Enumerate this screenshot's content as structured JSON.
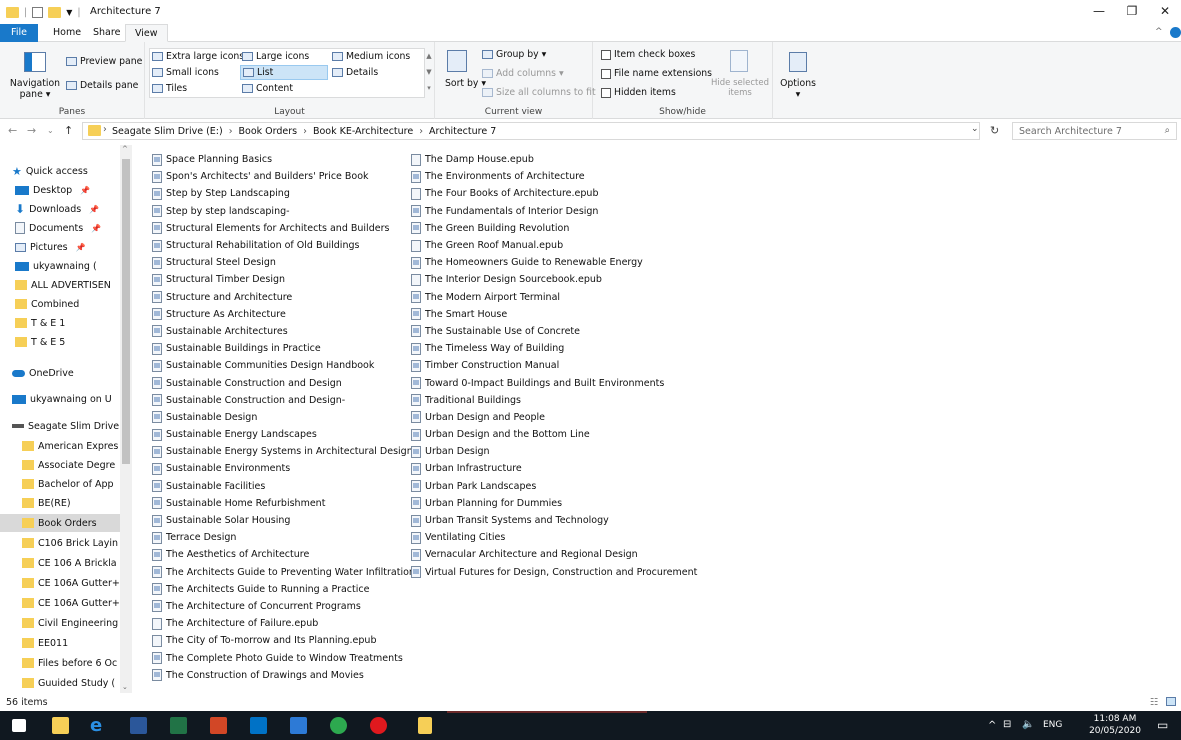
{
  "window": {
    "title": "Architecture 7"
  },
  "tabs": [
    "File",
    "Home",
    "Share",
    "View"
  ],
  "ribbon": {
    "panes": {
      "navigation_pane": "Navigation pane",
      "preview_pane": "Preview pane",
      "details_pane": "Details pane",
      "group_label": "Panes"
    },
    "layout": {
      "items": [
        "Extra large icons",
        "Large icons",
        "Medium icons",
        "Small icons",
        "List",
        "Details",
        "Tiles",
        "Content"
      ],
      "selected": "List",
      "group_label": "Layout"
    },
    "current_view": {
      "sort_by": "Sort by",
      "group_by": "Group by",
      "add_columns": "Add columns",
      "size_all_columns": "Size all columns to fit",
      "group_label": "Current view"
    },
    "show_hide": {
      "item_check_boxes": "Item check boxes",
      "file_name_extensions": "File name extensions",
      "hidden_items": "Hidden items",
      "hide_selected": "Hide selected items",
      "group_label": "Show/hide"
    },
    "options": "Options"
  },
  "address": {
    "breadcrumbs": [
      "Seagate Slim Drive (E:)",
      "Book Orders",
      "Book KE-Architecture",
      "Architecture 7"
    ],
    "search_placeholder": "Search Architecture 7"
  },
  "nav": {
    "quick_access": "Quick access",
    "quick_items": [
      "Desktop",
      "Downloads",
      "Documents",
      "Pictures",
      "ukyawnaing (",
      "ALL ADVERTISEN",
      "Combined",
      "T & E 1",
      "T & E 5"
    ],
    "onedrive": "OneDrive",
    "user": "ukyawnaing on U",
    "drive": "Seagate Slim Drive",
    "drive_items": [
      "American Expres",
      "Associate Degre",
      "Bachelor of App",
      "BE(RE)",
      "Book Orders",
      "C106 Brick Layin",
      "CE 106 A Brickla",
      "CE 106A Gutter+",
      "CE 106A Gutter+",
      "Civil Engineering",
      "EE011",
      "Files before 6 Oc",
      "Guuided Study ("
    ],
    "active": "Book Orders"
  },
  "files": {
    "col1": [
      {
        "name": "Space Planning Basics",
        "type": "pdf"
      },
      {
        "name": "Spon's Architects' and Builders' Price Book",
        "type": "pdf"
      },
      {
        "name": "Step by Step Landscaping",
        "type": "pdf"
      },
      {
        "name": "Step by step landscaping-",
        "type": "pdf"
      },
      {
        "name": "Structural Elements for Architects and Builders",
        "type": "pdf"
      },
      {
        "name": "Structural Rehabilitation of Old Buildings",
        "type": "pdf"
      },
      {
        "name": "Structural Steel Design",
        "type": "pdf"
      },
      {
        "name": "Structural Timber Design",
        "type": "pdf"
      },
      {
        "name": "Structure and Architecture",
        "type": "pdf"
      },
      {
        "name": "Structure As Architecture",
        "type": "pdf"
      },
      {
        "name": "Sustainable Architectures",
        "type": "pdf"
      },
      {
        "name": "Sustainable Buildings in Practice",
        "type": "pdf"
      },
      {
        "name": "Sustainable Communities Design Handbook",
        "type": "pdf"
      },
      {
        "name": "Sustainable Construction and Design",
        "type": "pdf"
      },
      {
        "name": "Sustainable Construction and Design-",
        "type": "pdf"
      },
      {
        "name": "Sustainable Design",
        "type": "pdf"
      },
      {
        "name": "Sustainable Energy Landscapes",
        "type": "pdf"
      },
      {
        "name": "Sustainable Energy Systems in Architectural Design",
        "type": "pdf"
      },
      {
        "name": "Sustainable Environments",
        "type": "pdf"
      },
      {
        "name": "Sustainable Facilities",
        "type": "pdf"
      },
      {
        "name": "Sustainable Home Refurbishment",
        "type": "pdf"
      },
      {
        "name": "Sustainable Solar Housing",
        "type": "pdf"
      },
      {
        "name": "Terrace Design",
        "type": "pdf"
      },
      {
        "name": "The Aesthetics of Architecture",
        "type": "pdf"
      },
      {
        "name": "The Architects Guide to Preventing Water Infiltration",
        "type": "pdf"
      },
      {
        "name": "The Architects Guide to Running a Practice",
        "type": "pdf"
      },
      {
        "name": "The Architecture of Concurrent Programs",
        "type": "pdf"
      },
      {
        "name": "The Architecture of Failure.epub",
        "type": "file"
      },
      {
        "name": "The City of To-morrow and Its Planning.epub",
        "type": "file"
      },
      {
        "name": "The Complete Photo Guide to Window Treatments",
        "type": "pdf"
      },
      {
        "name": "The Construction of Drawings and Movies",
        "type": "pdf"
      }
    ],
    "col2": [
      {
        "name": "The Damp House.epub",
        "type": "file"
      },
      {
        "name": "The Environments of Architecture",
        "type": "pdf"
      },
      {
        "name": "The Four Books of Architecture.epub",
        "type": "file"
      },
      {
        "name": "The Fundamentals of Interior Design",
        "type": "pdf"
      },
      {
        "name": "The Green Building Revolution",
        "type": "pdf"
      },
      {
        "name": "The Green Roof Manual.epub",
        "type": "file"
      },
      {
        "name": "The Homeowners Guide to Renewable Energy",
        "type": "pdf"
      },
      {
        "name": "The Interior Design Sourcebook.epub",
        "type": "file"
      },
      {
        "name": "The Modern Airport Terminal",
        "type": "pdf"
      },
      {
        "name": "The Smart House",
        "type": "pdf"
      },
      {
        "name": "The Sustainable Use of Concrete",
        "type": "pdf"
      },
      {
        "name": "The Timeless Way of Building",
        "type": "pdf"
      },
      {
        "name": "Timber Construction Manual",
        "type": "pdf"
      },
      {
        "name": "Toward 0-Impact Buildings and Built Environments",
        "type": "pdf"
      },
      {
        "name": "Traditional Buildings",
        "type": "pdf"
      },
      {
        "name": "Urban Design and People",
        "type": "pdf"
      },
      {
        "name": "Urban Design and the Bottom Line",
        "type": "pdf"
      },
      {
        "name": "Urban Design",
        "type": "pdf"
      },
      {
        "name": "Urban Infrastructure",
        "type": "pdf"
      },
      {
        "name": "Urban Park Landscapes",
        "type": "pdf"
      },
      {
        "name": "Urban Planning for Dummies",
        "type": "pdf"
      },
      {
        "name": "Urban Transit Systems and Technology",
        "type": "pdf"
      },
      {
        "name": "Ventilating Cities",
        "type": "pdf"
      },
      {
        "name": "Vernacular Architecture and Regional Design",
        "type": "pdf"
      },
      {
        "name": "Virtual Futures for Design, Construction and Procurement",
        "type": "pdf"
      }
    ]
  },
  "status": {
    "count": "56 items"
  },
  "taskbar": {
    "lang": "ENG",
    "time": "11:08 AM",
    "date": "20/05/2020"
  }
}
